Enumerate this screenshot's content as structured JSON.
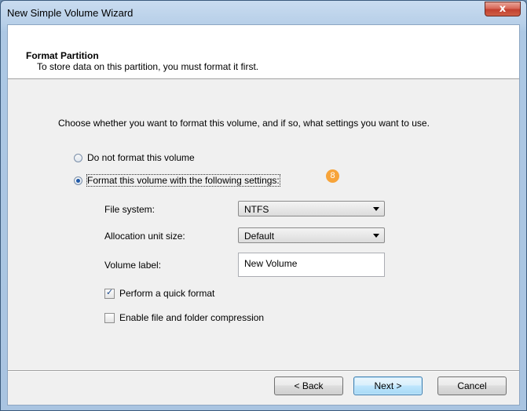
{
  "window": {
    "title": "New Simple Volume Wizard",
    "close_glyph": "x"
  },
  "header": {
    "title": "Format Partition",
    "subtitle": "To store data on this partition, you must format it first."
  },
  "intro": "Choose whether you want to format this volume, and if so, what settings you want to use.",
  "options": {
    "no_format": {
      "label": "Do not format this volume",
      "selected": false
    },
    "format": {
      "label": "Format this volume with the following settings:",
      "selected": true
    }
  },
  "badge": "8",
  "settings": {
    "file_system": {
      "label": "File system:",
      "value": "NTFS"
    },
    "allocation": {
      "label": "Allocation unit size:",
      "value": "Default"
    },
    "volume_label": {
      "label": "Volume label:",
      "value": "New Volume"
    }
  },
  "checks": {
    "quick_format": {
      "label": "Perform a quick format",
      "checked": true
    },
    "compression": {
      "label": "Enable file and folder compression",
      "checked": false
    }
  },
  "buttons": {
    "back": "< Back",
    "next": "Next >",
    "cancel": "Cancel"
  },
  "colors": {
    "accent": "#1e58a8",
    "badge": "#f7a43a",
    "close": "#c2402f"
  }
}
